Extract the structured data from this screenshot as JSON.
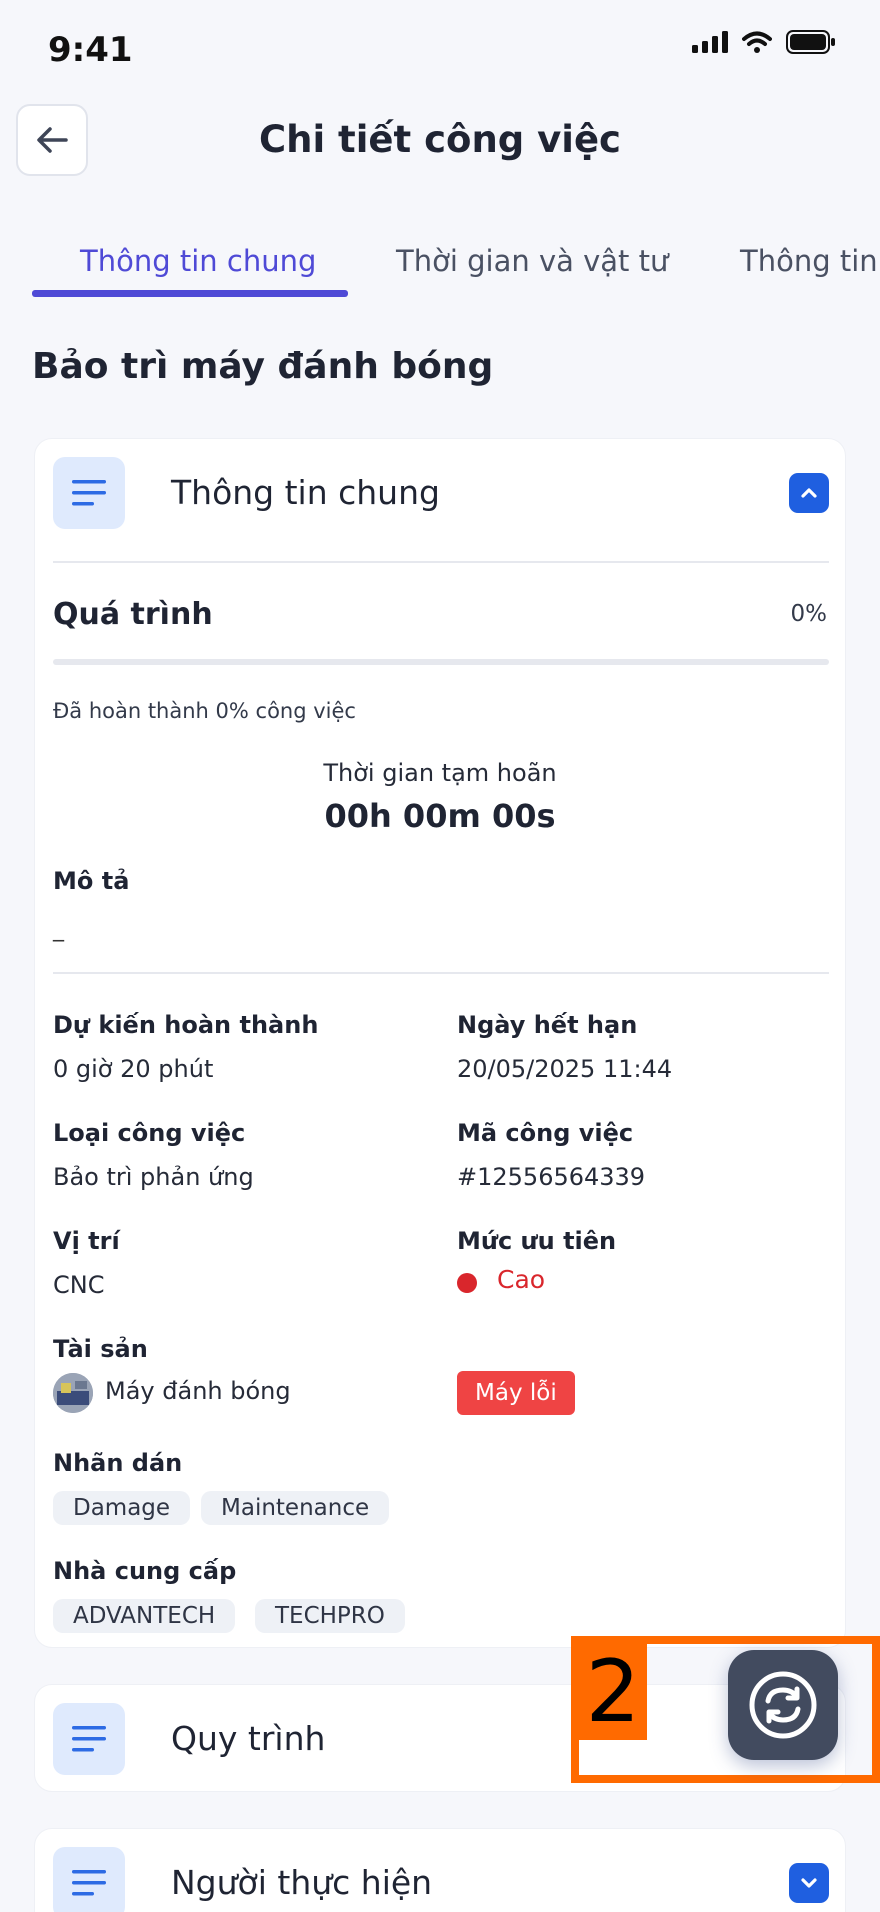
{
  "status_bar": {
    "time": "9:41"
  },
  "header": {
    "title": "Chi tiết công việc"
  },
  "tabs": [
    {
      "label": "Thông tin chung",
      "active": true
    },
    {
      "label": "Thời gian và vật tư",
      "active": false
    },
    {
      "label": "Thông tin x",
      "active": false
    }
  ],
  "job": {
    "title": "Bảo trì máy đánh bóng"
  },
  "general_card": {
    "title": "Thông tin chung",
    "progress": {
      "label": "Quá trình",
      "value_text": "0%",
      "percent": 0,
      "note": "Đã hoàn thành 0% công việc"
    },
    "pause": {
      "label": "Thời gian tạm hoãn",
      "value": "00h 00m 00s"
    },
    "description": {
      "label": "Mô tả",
      "value": "_"
    },
    "fields": {
      "expected_label": "Dự kiến hoàn thành",
      "expected_value": "0 giờ 20 phút",
      "due_label": "Ngày hết hạn",
      "due_value": "20/05/2025 11:44",
      "type_label": "Loại công việc",
      "type_value": "Bảo trì phản ứng",
      "code_label": "Mã công việc",
      "code_value": "#12556564339",
      "location_label": "Vị trí",
      "location_value": "CNC",
      "priority_label": "Mức ưu tiên",
      "priority_value": "Cao",
      "asset_label": "Tài sản",
      "asset_value": "Máy đánh bóng",
      "asset_status": "Máy lỗi",
      "tags_label": "Nhãn dán",
      "tags": [
        "Damage",
        "Maintenance"
      ],
      "suppliers_label": "Nhà cung cấp",
      "suppliers": [
        "ADVANTECH",
        "TECHPRO"
      ]
    }
  },
  "process_card": {
    "title": "Quy trình"
  },
  "performer_card": {
    "title": "Người thực hiện"
  },
  "overlay": {
    "number": "2"
  },
  "colors": {
    "accent": "#4f4ad6",
    "blue": "#1f5fe0",
    "danger": "#ef4444",
    "overlay": "#ff6a00"
  },
  "icons": [
    "back-arrow-icon",
    "list-icon",
    "chevron-up-icon",
    "chevron-down-icon",
    "sync-icon"
  ]
}
